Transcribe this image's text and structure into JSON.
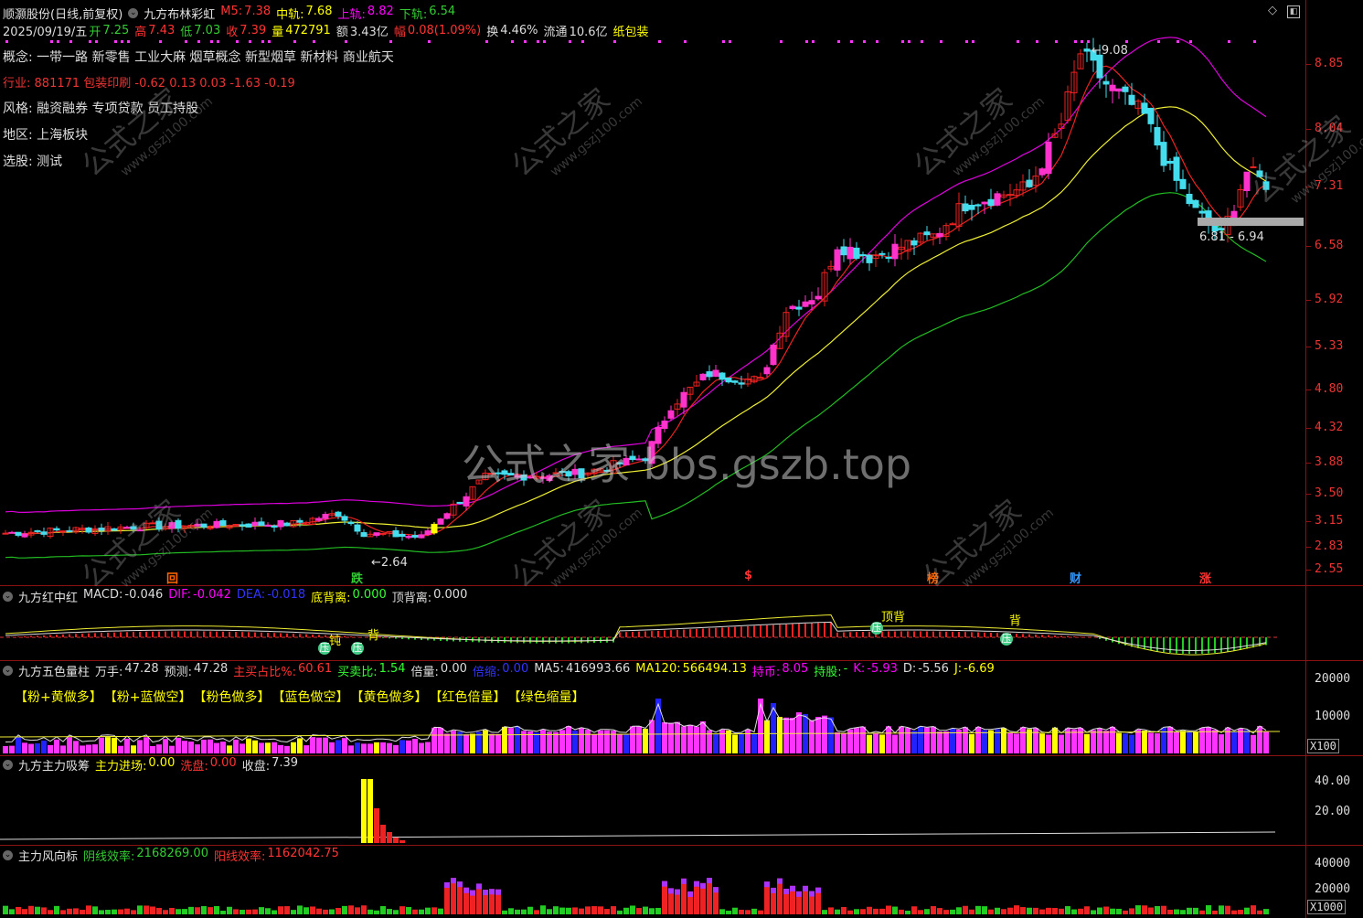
{
  "header": {
    "stock": "顺灏股份(日线,前复权)",
    "indicator": "九方布林彩虹",
    "items": [
      {
        "k": "M5:",
        "v": "7.38",
        "kc": "#f33",
        "vc": "#f33"
      },
      {
        "k": "中轨:",
        "v": "7.68",
        "kc": "#ff0",
        "vc": "#ff0"
      },
      {
        "k": "上轨:",
        "v": "8.82",
        "kc": "#f0f",
        "vc": "#f0f"
      },
      {
        "k": "下轨:",
        "v": "6.54",
        "kc": "#3c3",
        "vc": "#3c3"
      }
    ]
  },
  "quote": {
    "date": "2025/09/19/五",
    "open_k": "开",
    "open": "7.25",
    "high_k": "高",
    "high": "7.43",
    "low_k": "低",
    "low": "7.03",
    "close_k": "收",
    "close": "7.39",
    "vol_k": "量",
    "vol": "472791",
    "amt_k": "额",
    "amt": "3.43亿",
    "chg_k": "幅",
    "chg": "0.08(1.09%)",
    "turn_k": "换",
    "turn": "4.46%",
    "float_k": "流通",
    "float": "10.6亿",
    "sector": "纸包装"
  },
  "info": {
    "concept_k": "概念:",
    "concept": "一带一路 新零售 工业大麻 烟草概念 新型烟草 新材料 商业航天",
    "industry_k": "行业:",
    "industry": "881171 包装印刷 -0.62 0.13 0.03 -1.63 -0.19",
    "style_k": "风格:",
    "style": "融资融券 专项贷款 员工持股",
    "region_k": "地区:",
    "region": "上海板块",
    "pick_k": "选股:",
    "pick": "测试"
  },
  "price_axis": [
    "8.85",
    "8.04",
    "7.31",
    "6.58",
    "5.92",
    "5.33",
    "4.80",
    "4.32",
    "3.88",
    "3.50",
    "3.15",
    "2.83",
    "2.55"
  ],
  "annotations": {
    "high_mark": "9.08",
    "low_mark": "2.64",
    "range_label": "6.81 - 6.94"
  },
  "watermark": {
    "center": "公式之家 bbs.gszb.top",
    "tile_cn": "公式之家",
    "tile_en": "www.gszj100.com"
  },
  "bottom_signals": [
    "回",
    "跌",
    "$",
    "榜",
    "财",
    "涨"
  ],
  "macd": {
    "name": "九方红中红",
    "items": [
      {
        "k": "MACD:",
        "v": "-0.046",
        "kc": "#ddd",
        "vc": "#ddd"
      },
      {
        "k": "DIF:",
        "v": "-0.042",
        "kc": "#f0f",
        "vc": "#f0f"
      },
      {
        "k": "DEA:",
        "v": "-0.018",
        "kc": "#33f",
        "vc": "#33f"
      },
      {
        "k": "底背离:",
        "v": "0.000",
        "kc": "#ff0",
        "vc": "#3f3"
      },
      {
        "k": "顶背离:",
        "v": "0.000",
        "kc": "#ddd",
        "vc": "#ddd"
      }
    ],
    "marks": [
      "压",
      "压",
      "压",
      "压",
      "钝",
      "背",
      "顶背",
      "背"
    ]
  },
  "volume": {
    "name": "九方五色量柱",
    "items": [
      {
        "k": "万手:",
        "v": "47.28",
        "kc": "#ddd",
        "vc": "#ddd"
      },
      {
        "k": "预测:",
        "v": "47.28",
        "kc": "#ddd",
        "vc": "#ddd"
      },
      {
        "k": "主买占比%:",
        "v": "60.61",
        "kc": "#f33",
        "vc": "#f33"
      },
      {
        "k": "买卖比:",
        "v": "1.54",
        "kc": "#3f3",
        "vc": "#3f3"
      },
      {
        "k": "倍量:",
        "v": "0.00",
        "kc": "#ddd",
        "vc": "#ddd"
      },
      {
        "k": "倍缩:",
        "v": "0.00",
        "kc": "#33f",
        "vc": "#33f"
      },
      {
        "k": "MA5:",
        "v": "416993.66",
        "kc": "#ddd",
        "vc": "#ddd"
      },
      {
        "k": "MA120:",
        "v": "566494.13",
        "kc": "#ff0",
        "vc": "#ff0"
      },
      {
        "k": "持币:",
        "v": "8.05",
        "kc": "#f0f",
        "vc": "#f0f"
      },
      {
        "k": "持股:",
        "v": "-",
        "kc": "#3f3",
        "vc": "#3f3"
      },
      {
        "k": "K:",
        "v": "-5.93",
        "kc": "#f0f",
        "vc": "#f0f"
      },
      {
        "k": "D:",
        "v": "-5.56",
        "kc": "#ddd",
        "vc": "#ddd"
      },
      {
        "k": "J:",
        "v": "-6.69",
        "kc": "#ff0",
        "vc": "#ff0"
      }
    ],
    "legend": [
      "【粉+黄做多】",
      "【粉+蓝做空】",
      "【粉色做多】",
      "【蓝色做空】",
      "【黄色做多】",
      "【红色倍量】",
      "【绿色缩量】"
    ],
    "axis": [
      "20000",
      "10000"
    ],
    "unit": "X100"
  },
  "capital": {
    "name": "九方主力吸筹",
    "items": [
      {
        "k": "主力进场:",
        "v": "0.00",
        "kc": "#ff0",
        "vc": "#ff0"
      },
      {
        "k": "洗盘:",
        "v": "0.00",
        "kc": "#f33",
        "vc": "#f33"
      },
      {
        "k": "收盘:",
        "v": "7.39",
        "kc": "#ddd",
        "vc": "#ddd"
      }
    ],
    "axis": [
      "40.00",
      "20.00"
    ]
  },
  "wind": {
    "name": "主力风向标",
    "items": [
      {
        "k": "阴线效率:",
        "v": "2168269.00",
        "kc": "#3c3",
        "vc": "#3c3"
      },
      {
        "k": "阳线效率:",
        "v": "1162042.75",
        "kc": "#f33",
        "vc": "#f33"
      }
    ],
    "axis": [
      "40000",
      "20000"
    ],
    "unit": "X1000"
  }
}
